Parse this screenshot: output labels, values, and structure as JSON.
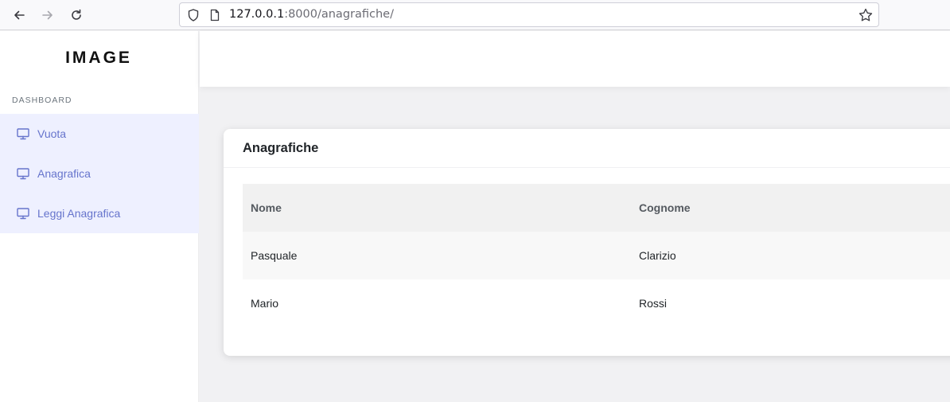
{
  "browser": {
    "url_host": "127.0.0.1",
    "url_rest": ":8000/anagrafiche/"
  },
  "sidebar": {
    "brand": "IMAGE",
    "section_label": "DASHBOARD",
    "items": [
      {
        "label": "Vuota",
        "icon": "monitor-icon"
      },
      {
        "label": "Anagrafica",
        "icon": "monitor-icon"
      },
      {
        "label": "Leggi Anagrafica",
        "icon": "monitor-icon"
      }
    ]
  },
  "card": {
    "title": "Anagrafiche",
    "columns": [
      "Nome",
      "Cognome"
    ],
    "rows": [
      [
        "Pasquale",
        "Clarizio"
      ],
      [
        "Mario",
        "Rossi"
      ]
    ]
  },
  "colors": {
    "accent": "#6674cc",
    "menu_bg": "#eef0ff",
    "page_bg": "#f1f1f3"
  }
}
